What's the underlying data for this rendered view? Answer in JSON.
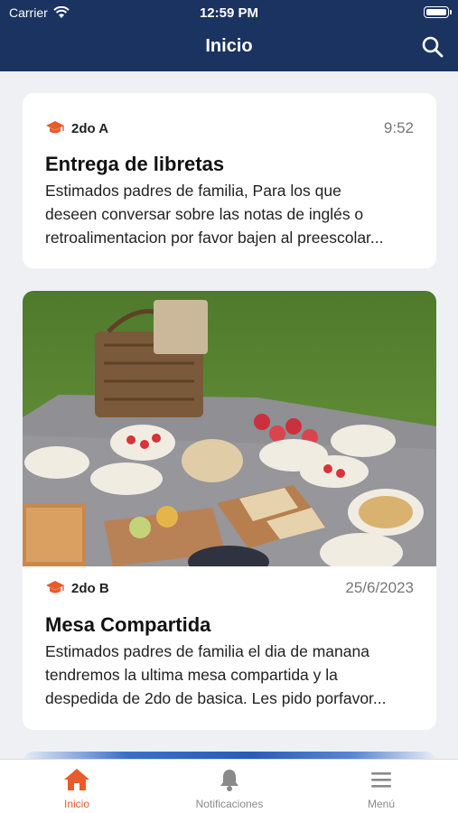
{
  "status_bar": {
    "carrier": "Carrier",
    "time": "12:59 PM"
  },
  "header": {
    "title": "Inicio",
    "search_icon": "search-icon"
  },
  "posts": [
    {
      "grade": "2do A",
      "time": "9:52",
      "title": "Entrega de libretas",
      "body_lines": [
        "Estimados padres de familia, Para los que",
        "deseen conversar sobre las notas de inglés o",
        "retroalimentacion por favor bajen al preescolar..."
      ]
    },
    {
      "grade": "2do B",
      "time": "25/6/2023",
      "title": "Mesa Compartida",
      "body_lines": [
        "Estimados padres de familia el dia de manana",
        "tendremos la ultima mesa compartida y la",
        "despedida de 2do de basica. Les pido porfavor..."
      ],
      "image": "picnic-photo"
    }
  ],
  "tabs": [
    {
      "label": "Inicio",
      "icon": "home-icon",
      "active": true
    },
    {
      "label": "Notificaciones",
      "icon": "bell-icon",
      "active": false
    },
    {
      "label": "Menú",
      "icon": "menu-icon",
      "active": false
    }
  ],
  "colors": {
    "header": "#1a3361",
    "accent": "#e85c2c",
    "background": "#eef0f4"
  }
}
